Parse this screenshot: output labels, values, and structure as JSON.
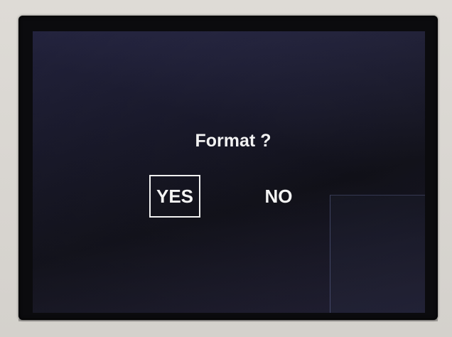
{
  "dialog": {
    "title": "Format ?",
    "options": [
      {
        "label": "YES",
        "selected": true
      },
      {
        "label": "NO",
        "selected": false
      }
    ]
  },
  "colors": {
    "screen_background": "#1a1a2c",
    "text": "#f4f4f4",
    "selection_border": "#f0f0f0",
    "bezel": "#0b0b0e",
    "device_body": "#d8d5d0"
  }
}
